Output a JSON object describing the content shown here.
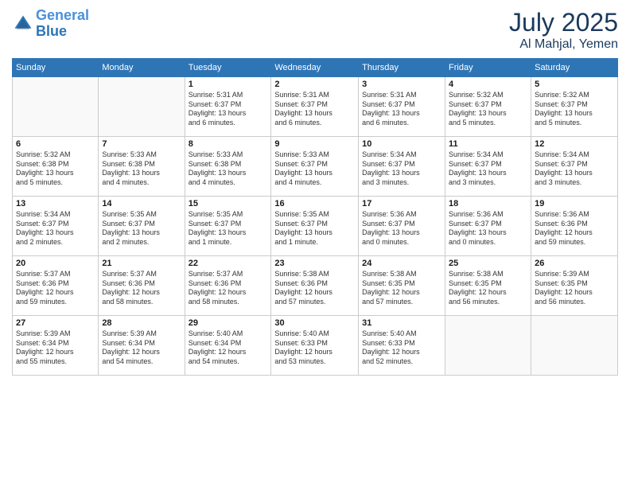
{
  "header": {
    "logo_line1": "General",
    "logo_line2": "Blue",
    "month": "July 2025",
    "location": "Al Mahjal, Yemen"
  },
  "days_of_week": [
    "Sunday",
    "Monday",
    "Tuesday",
    "Wednesday",
    "Thursday",
    "Friday",
    "Saturday"
  ],
  "weeks": [
    [
      {
        "day": "",
        "info": ""
      },
      {
        "day": "",
        "info": ""
      },
      {
        "day": "1",
        "info": "Sunrise: 5:31 AM\nSunset: 6:37 PM\nDaylight: 13 hours\nand 6 minutes."
      },
      {
        "day": "2",
        "info": "Sunrise: 5:31 AM\nSunset: 6:37 PM\nDaylight: 13 hours\nand 6 minutes."
      },
      {
        "day": "3",
        "info": "Sunrise: 5:31 AM\nSunset: 6:37 PM\nDaylight: 13 hours\nand 6 minutes."
      },
      {
        "day": "4",
        "info": "Sunrise: 5:32 AM\nSunset: 6:37 PM\nDaylight: 13 hours\nand 5 minutes."
      },
      {
        "day": "5",
        "info": "Sunrise: 5:32 AM\nSunset: 6:37 PM\nDaylight: 13 hours\nand 5 minutes."
      }
    ],
    [
      {
        "day": "6",
        "info": "Sunrise: 5:32 AM\nSunset: 6:38 PM\nDaylight: 13 hours\nand 5 minutes."
      },
      {
        "day": "7",
        "info": "Sunrise: 5:33 AM\nSunset: 6:38 PM\nDaylight: 13 hours\nand 4 minutes."
      },
      {
        "day": "8",
        "info": "Sunrise: 5:33 AM\nSunset: 6:38 PM\nDaylight: 13 hours\nand 4 minutes."
      },
      {
        "day": "9",
        "info": "Sunrise: 5:33 AM\nSunset: 6:37 PM\nDaylight: 13 hours\nand 4 minutes."
      },
      {
        "day": "10",
        "info": "Sunrise: 5:34 AM\nSunset: 6:37 PM\nDaylight: 13 hours\nand 3 minutes."
      },
      {
        "day": "11",
        "info": "Sunrise: 5:34 AM\nSunset: 6:37 PM\nDaylight: 13 hours\nand 3 minutes."
      },
      {
        "day": "12",
        "info": "Sunrise: 5:34 AM\nSunset: 6:37 PM\nDaylight: 13 hours\nand 3 minutes."
      }
    ],
    [
      {
        "day": "13",
        "info": "Sunrise: 5:34 AM\nSunset: 6:37 PM\nDaylight: 13 hours\nand 2 minutes."
      },
      {
        "day": "14",
        "info": "Sunrise: 5:35 AM\nSunset: 6:37 PM\nDaylight: 13 hours\nand 2 minutes."
      },
      {
        "day": "15",
        "info": "Sunrise: 5:35 AM\nSunset: 6:37 PM\nDaylight: 13 hours\nand 1 minute."
      },
      {
        "day": "16",
        "info": "Sunrise: 5:35 AM\nSunset: 6:37 PM\nDaylight: 13 hours\nand 1 minute."
      },
      {
        "day": "17",
        "info": "Sunrise: 5:36 AM\nSunset: 6:37 PM\nDaylight: 13 hours\nand 0 minutes."
      },
      {
        "day": "18",
        "info": "Sunrise: 5:36 AM\nSunset: 6:37 PM\nDaylight: 13 hours\nand 0 minutes."
      },
      {
        "day": "19",
        "info": "Sunrise: 5:36 AM\nSunset: 6:36 PM\nDaylight: 12 hours\nand 59 minutes."
      }
    ],
    [
      {
        "day": "20",
        "info": "Sunrise: 5:37 AM\nSunset: 6:36 PM\nDaylight: 12 hours\nand 59 minutes."
      },
      {
        "day": "21",
        "info": "Sunrise: 5:37 AM\nSunset: 6:36 PM\nDaylight: 12 hours\nand 58 minutes."
      },
      {
        "day": "22",
        "info": "Sunrise: 5:37 AM\nSunset: 6:36 PM\nDaylight: 12 hours\nand 58 minutes."
      },
      {
        "day": "23",
        "info": "Sunrise: 5:38 AM\nSunset: 6:36 PM\nDaylight: 12 hours\nand 57 minutes."
      },
      {
        "day": "24",
        "info": "Sunrise: 5:38 AM\nSunset: 6:35 PM\nDaylight: 12 hours\nand 57 minutes."
      },
      {
        "day": "25",
        "info": "Sunrise: 5:38 AM\nSunset: 6:35 PM\nDaylight: 12 hours\nand 56 minutes."
      },
      {
        "day": "26",
        "info": "Sunrise: 5:39 AM\nSunset: 6:35 PM\nDaylight: 12 hours\nand 56 minutes."
      }
    ],
    [
      {
        "day": "27",
        "info": "Sunrise: 5:39 AM\nSunset: 6:34 PM\nDaylight: 12 hours\nand 55 minutes."
      },
      {
        "day": "28",
        "info": "Sunrise: 5:39 AM\nSunset: 6:34 PM\nDaylight: 12 hours\nand 54 minutes."
      },
      {
        "day": "29",
        "info": "Sunrise: 5:40 AM\nSunset: 6:34 PM\nDaylight: 12 hours\nand 54 minutes."
      },
      {
        "day": "30",
        "info": "Sunrise: 5:40 AM\nSunset: 6:33 PM\nDaylight: 12 hours\nand 53 minutes."
      },
      {
        "day": "31",
        "info": "Sunrise: 5:40 AM\nSunset: 6:33 PM\nDaylight: 12 hours\nand 52 minutes."
      },
      {
        "day": "",
        "info": ""
      },
      {
        "day": "",
        "info": ""
      }
    ]
  ]
}
